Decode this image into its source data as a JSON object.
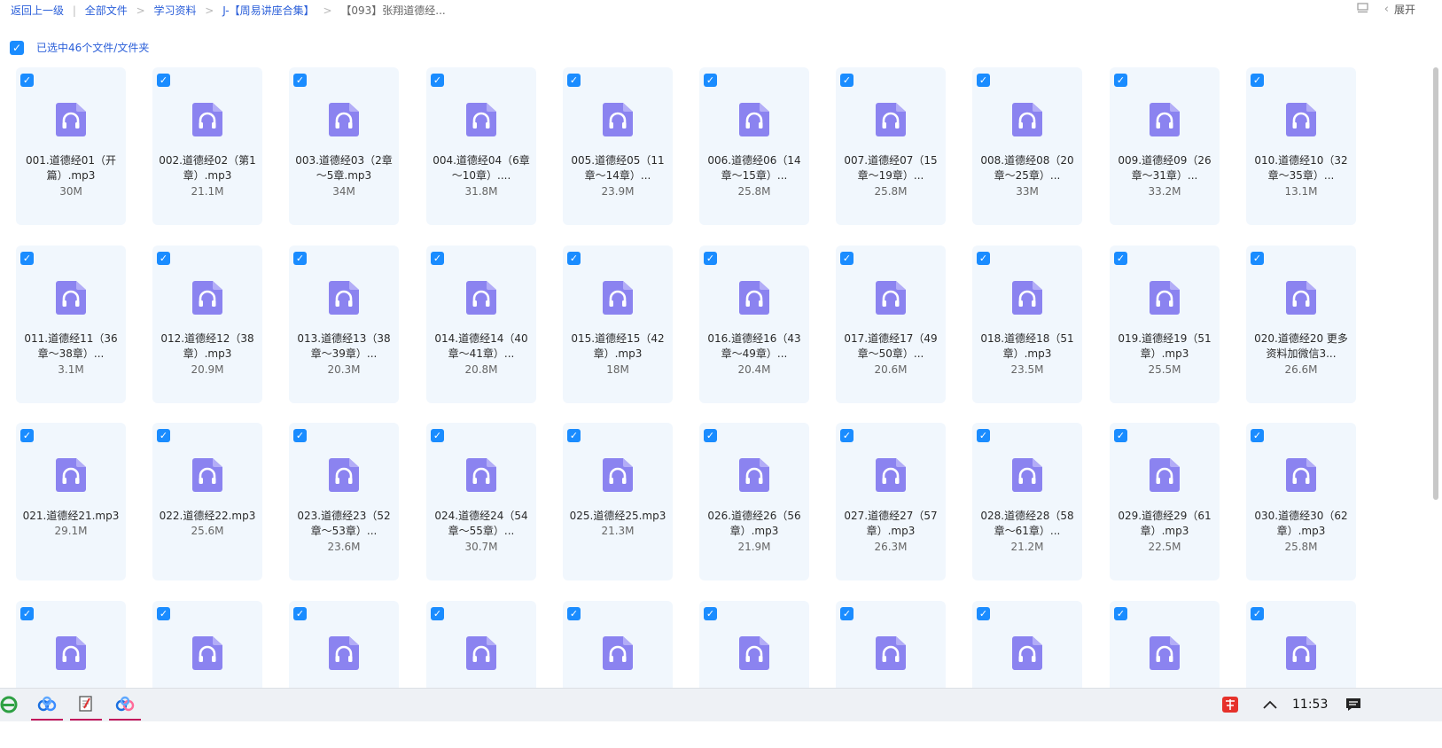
{
  "breadcrumb": {
    "back": "返回上一级",
    "items": [
      "全部文件",
      "学习资料",
      "J-【周易讲座合集】",
      "【093】张翔道德经..."
    ]
  },
  "toolbar": {
    "expand_label": "展开",
    "collapse_chevron": "‹",
    "view_icon": "list-view-icon"
  },
  "selection": {
    "label": "已选中46个文件/文件夹",
    "checked": true
  },
  "files": [
    {
      "name": "001.道德经01（开篇）.mp3",
      "size": "30M"
    },
    {
      "name": "002.道德经02（第1章）.mp3",
      "size": "21.1M"
    },
    {
      "name": "003.道德经03（2章～5章.mp3",
      "size": "34M"
    },
    {
      "name": "004.道德经04（6章～10章）....",
      "size": "31.8M"
    },
    {
      "name": "005.道德经05（11章～14章）...",
      "size": "23.9M"
    },
    {
      "name": "006.道德经06（14章～15章）...",
      "size": "25.8M"
    },
    {
      "name": "007.道德经07（15章～19章）...",
      "size": "25.8M"
    },
    {
      "name": "008.道德经08（20章～25章）...",
      "size": "33M"
    },
    {
      "name": "009.道德经09（26章～31章）...",
      "size": "33.2M"
    },
    {
      "name": "010.道德经10（32章～35章）...",
      "size": "13.1M"
    },
    {
      "name": "011.道德经11（36章～38章）...",
      "size": "3.1M"
    },
    {
      "name": "012.道德经12（38章）.mp3",
      "size": "20.9M"
    },
    {
      "name": "013.道德经13（38章～39章）...",
      "size": "20.3M"
    },
    {
      "name": "014.道德经14（40章～41章）...",
      "size": "20.8M"
    },
    {
      "name": "015.道德经15（42章）.mp3",
      "size": "18M"
    },
    {
      "name": "016.道德经16（43章～49章）...",
      "size": "20.4M"
    },
    {
      "name": "017.道德经17（49章～50章）...",
      "size": "20.6M"
    },
    {
      "name": "018.道德经18（51章）.mp3",
      "size": "23.5M"
    },
    {
      "name": "019.道德经19（51章）.mp3",
      "size": "25.5M"
    },
    {
      "name": "020.道德经20 更多资料加微信3...",
      "size": "26.6M"
    },
    {
      "name": "021.道德经21.mp3",
      "size": "29.1M"
    },
    {
      "name": "022.道德经22.mp3",
      "size": "25.6M"
    },
    {
      "name": "023.道德经23（52章～53章）...",
      "size": "23.6M"
    },
    {
      "name": "024.道德经24（54章～55章）...",
      "size": "30.7M"
    },
    {
      "name": "025.道德经25.mp3",
      "size": "21.3M"
    },
    {
      "name": "026.道德经26（56章）.mp3",
      "size": "21.9M"
    },
    {
      "name": "027.道德经27（57章）.mp3",
      "size": "26.3M"
    },
    {
      "name": "028.道德经28（58章～61章）...",
      "size": "21.2M"
    },
    {
      "name": "029.道德经29（61章）.mp3",
      "size": "22.5M"
    },
    {
      "name": "030.道德经30（62章）.mp3",
      "size": "25.8M"
    },
    {
      "name": "",
      "size": ""
    },
    {
      "name": "",
      "size": ""
    },
    {
      "name": "",
      "size": ""
    },
    {
      "name": "",
      "size": ""
    },
    {
      "name": "",
      "size": ""
    },
    {
      "name": "",
      "size": ""
    },
    {
      "name": "",
      "size": ""
    },
    {
      "name": "",
      "size": ""
    },
    {
      "name": "",
      "size": ""
    },
    {
      "name": "",
      "size": ""
    }
  ],
  "taskbar": {
    "apps": [
      "ie-icon",
      "baidu-netdisk-icon",
      "notepad-icon",
      "baidu-netdisk-active-icon"
    ],
    "clock": "11:53",
    "tray_icons": [
      "input-method-icon",
      "tray-chevron-up-icon",
      "notification-icon"
    ]
  },
  "colors": {
    "accent": "#1a8cff",
    "card_bg": "#f1f7fd",
    "audio_icon": "#8b83f0",
    "link": "#2b5fd9"
  }
}
